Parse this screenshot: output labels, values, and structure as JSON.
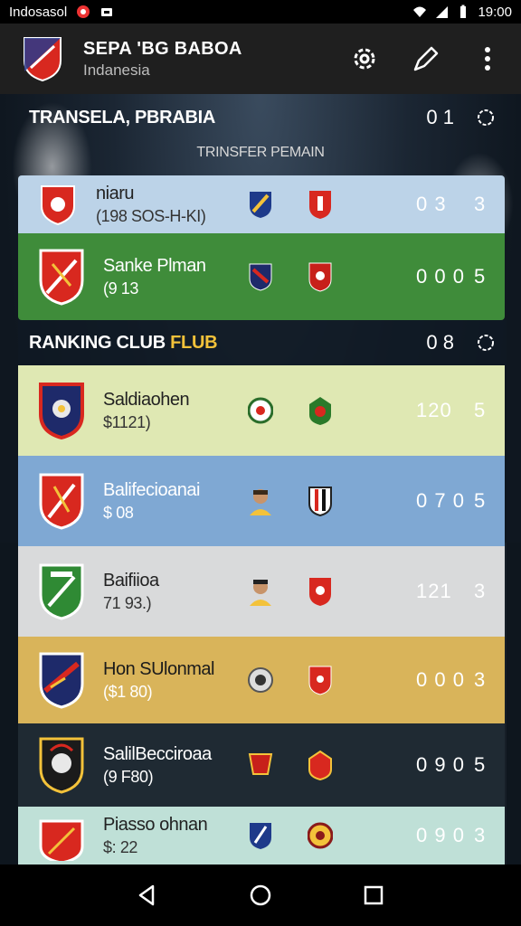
{
  "status": {
    "carrier": "Indosasol",
    "time": "19:00"
  },
  "app": {
    "title": "SEPA 'BG BABOA",
    "subtitle": "Indanesia",
    "actions": [
      "settings",
      "edit",
      "more"
    ]
  },
  "transfer_section": {
    "title": "TRANSELA, PBRABIA",
    "count": "0 1",
    "subtitle": "TRINSFER PEMAIN",
    "rows": [
      {
        "name": "niaru",
        "sub": "(198 SOS-H-KI)",
        "score": "0 3",
        "rank": "3",
        "bg": "#bcd3e8",
        "light": true
      },
      {
        "name": "Sanke Plman",
        "sub": "(9 13",
        "score": "0 0 0",
        "rank": "5",
        "bg": "#3f8c3a",
        "light": false
      }
    ]
  },
  "ranking_section": {
    "title": "RANKING CLUB",
    "title_accent": "FLUB",
    "count": "0 8",
    "rows": [
      {
        "name": "Saldiaohen",
        "sub": "$1121)",
        "score": "120",
        "rank": "5",
        "bg": "#dfe8b3",
        "light": true
      },
      {
        "name": "Balifecioanai",
        "sub": "$ 08",
        "score": "0 7 0",
        "rank": "5",
        "bg": "#7fa8d3",
        "light": false
      },
      {
        "name": "Baifiioa",
        "sub": "71 93.)",
        "score": "121",
        "rank": "3",
        "bg": "#d9dadb",
        "light": true
      },
      {
        "name": "Hon SUlonmal",
        "sub": "($1 80)",
        "score": "0 0 0",
        "rank": "3",
        "bg": "#d9b45a",
        "light": false
      },
      {
        "name": "SalilBecciroaa",
        "sub": "(9 F80)",
        "score": "0 9 0",
        "rank": "5",
        "bg": "#1f2a33",
        "light": false
      },
      {
        "name": "Piasso ohnan",
        "sub": "$: 22",
        "score": "0 9 0",
        "rank": "3",
        "bg": "#bfe0d7",
        "light": true
      }
    ]
  },
  "colors": {
    "appbar": "#1f1f1f",
    "accent": "#f3c23a",
    "crest_red": "#d8281f"
  }
}
